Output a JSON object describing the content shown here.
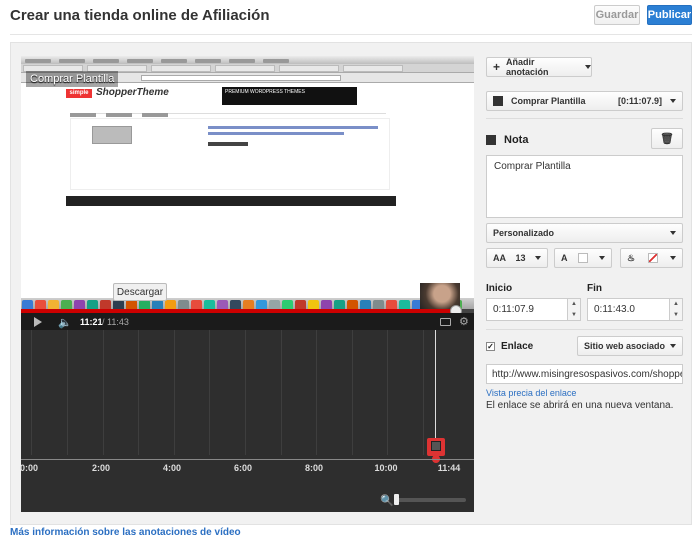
{
  "header": {
    "title": "Crear una tienda online de Afiliación",
    "save_label": "Guardar",
    "publish_label": "Publicar"
  },
  "video": {
    "annotation_text": "Comprar Plantilla",
    "download_label": "Descargar",
    "blog_logo": "simple",
    "blog_title": "ShopperTheme",
    "banner_text": "PREMIUM WORDPRESS THEMES",
    "current_time": "11:21",
    "total_time": "/ 11:43"
  },
  "timeline": {
    "ticks": [
      "0:00",
      "2:00",
      "4:00",
      "6:00",
      "8:00",
      "10:00",
      "11:44"
    ]
  },
  "sidebar": {
    "add_annotation_label": "Añadir anotación",
    "annotation_name": "Comprar Plantilla",
    "annotation_time": "[0:11:07.9]",
    "nota_label": "Nota",
    "note_text": "Comprar Plantilla",
    "style_value": "Personalizado",
    "font_size": "13",
    "font_glyph": "A",
    "start_label": "Inicio",
    "start_value": "0:11:07.9",
    "end_label": "Fin",
    "end_value": "0:11:43.0",
    "link_label": "Enlace",
    "link_type": "Sitio web asociado",
    "link_url": "http://www.misingresospasivos.com/shopperp",
    "preview_link": "Vista precia del enlace",
    "new_window_text": "El enlace se abrirá en una nueva ventana."
  },
  "footer": {
    "more_info": "Más información sobre las anotaciones de vídeo"
  },
  "colors": {
    "accent": "#2b7fd4",
    "progress": "#cc0000",
    "link": "#2b6fc2"
  }
}
